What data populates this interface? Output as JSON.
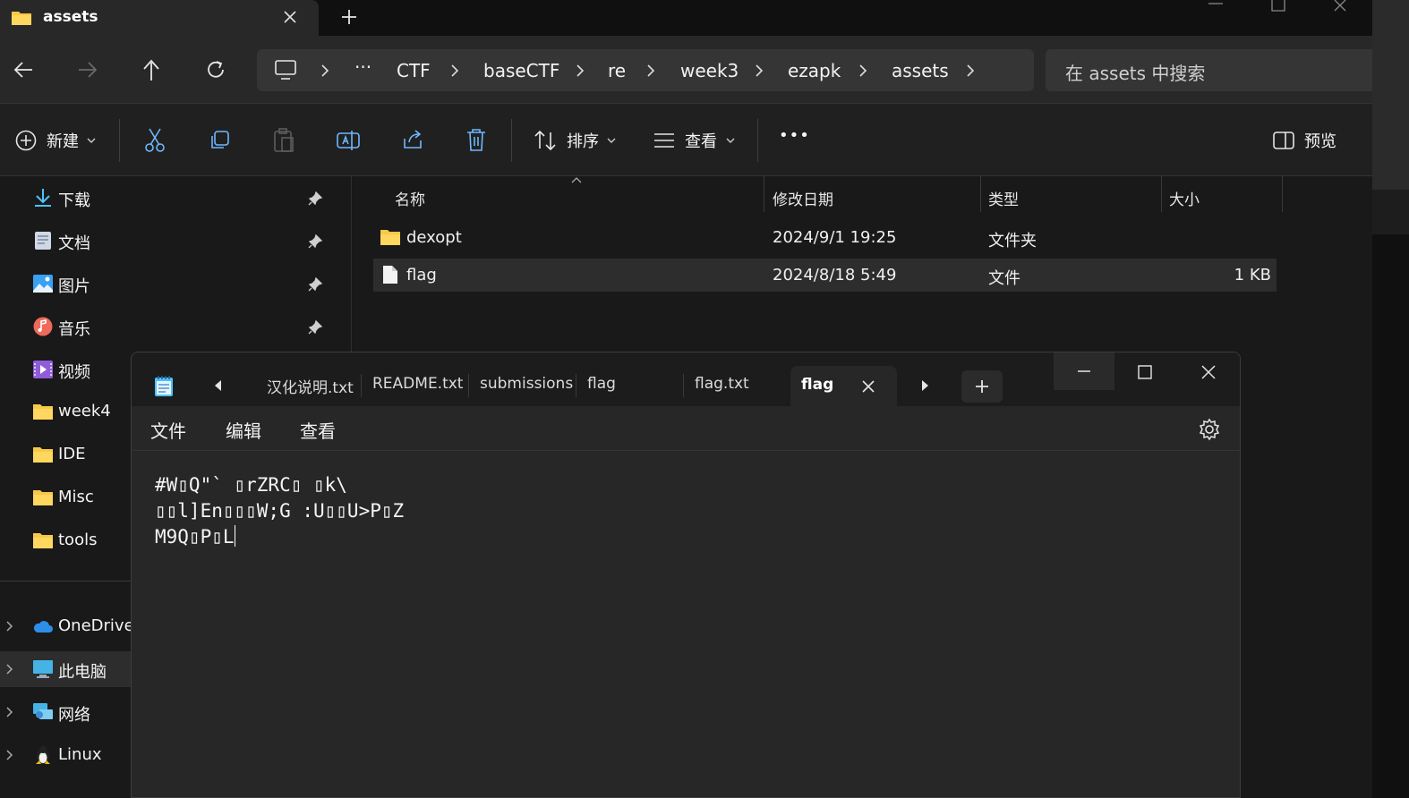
{
  "explorer": {
    "tab_title": "assets",
    "breadcrumb": [
      "CTF",
      "baseCTF",
      "re",
      "week3",
      "ezapk",
      "assets"
    ],
    "breadcrumb_more": "···",
    "search_placeholder": "在 assets 中搜索",
    "toolbar": {
      "new_label": "新建",
      "sort_label": "排序",
      "view_label": "查看",
      "more_label": "•••",
      "preview_label": "预览"
    },
    "nav": {
      "quick_access": [
        {
          "label": "下载",
          "icon": "download-icon",
          "pinned": true
        },
        {
          "label": "文档",
          "icon": "documents-icon",
          "pinned": true
        },
        {
          "label": "图片",
          "icon": "pictures-icon",
          "pinned": true
        },
        {
          "label": "音乐",
          "icon": "music-icon",
          "pinned": true
        },
        {
          "label": "视频",
          "icon": "videos-icon",
          "pinned": false
        },
        {
          "label": "week4",
          "icon": "folder-icon",
          "pinned": false
        },
        {
          "label": "IDE",
          "icon": "folder-icon",
          "pinned": false
        },
        {
          "label": "Misc",
          "icon": "folder-icon",
          "pinned": false
        },
        {
          "label": "tools",
          "icon": "folder-icon",
          "pinned": false
        }
      ],
      "locations": [
        {
          "label": "OneDrive",
          "icon": "cloud-icon"
        },
        {
          "label": "此电脑",
          "icon": "computer-icon"
        },
        {
          "label": "网络",
          "icon": "network-icon"
        },
        {
          "label": "Linux",
          "icon": "linux-icon"
        }
      ]
    },
    "columns": {
      "name": "名称",
      "modified": "修改日期",
      "type": "类型",
      "size": "大小"
    },
    "files": [
      {
        "name": "dexopt",
        "modified": "2024/9/1 19:25",
        "type": "文件夹",
        "size": ""
      },
      {
        "name": "flag",
        "modified": "2024/8/18 5:49",
        "type": "文件",
        "size": "1 KB"
      }
    ]
  },
  "notepad": {
    "tabs": [
      "汉化说明.txt",
      "README.txt",
      "submissions",
      "flag",
      "flag.txt"
    ],
    "active_tab": "flag",
    "menu": {
      "file": "文件",
      "edit": "编辑",
      "view": "查看"
    },
    "content_lines": [
      "#W▯Q\"` ▯rZRC▯ ▯k\\",
      "▯▯l]En▯▯▯W;G :U▯▯U>P▯Z",
      "M9Q▯P▯L"
    ]
  },
  "colors": {
    "accent": "#4cc2ff",
    "folder": "#f7c948",
    "background": "#191919"
  }
}
